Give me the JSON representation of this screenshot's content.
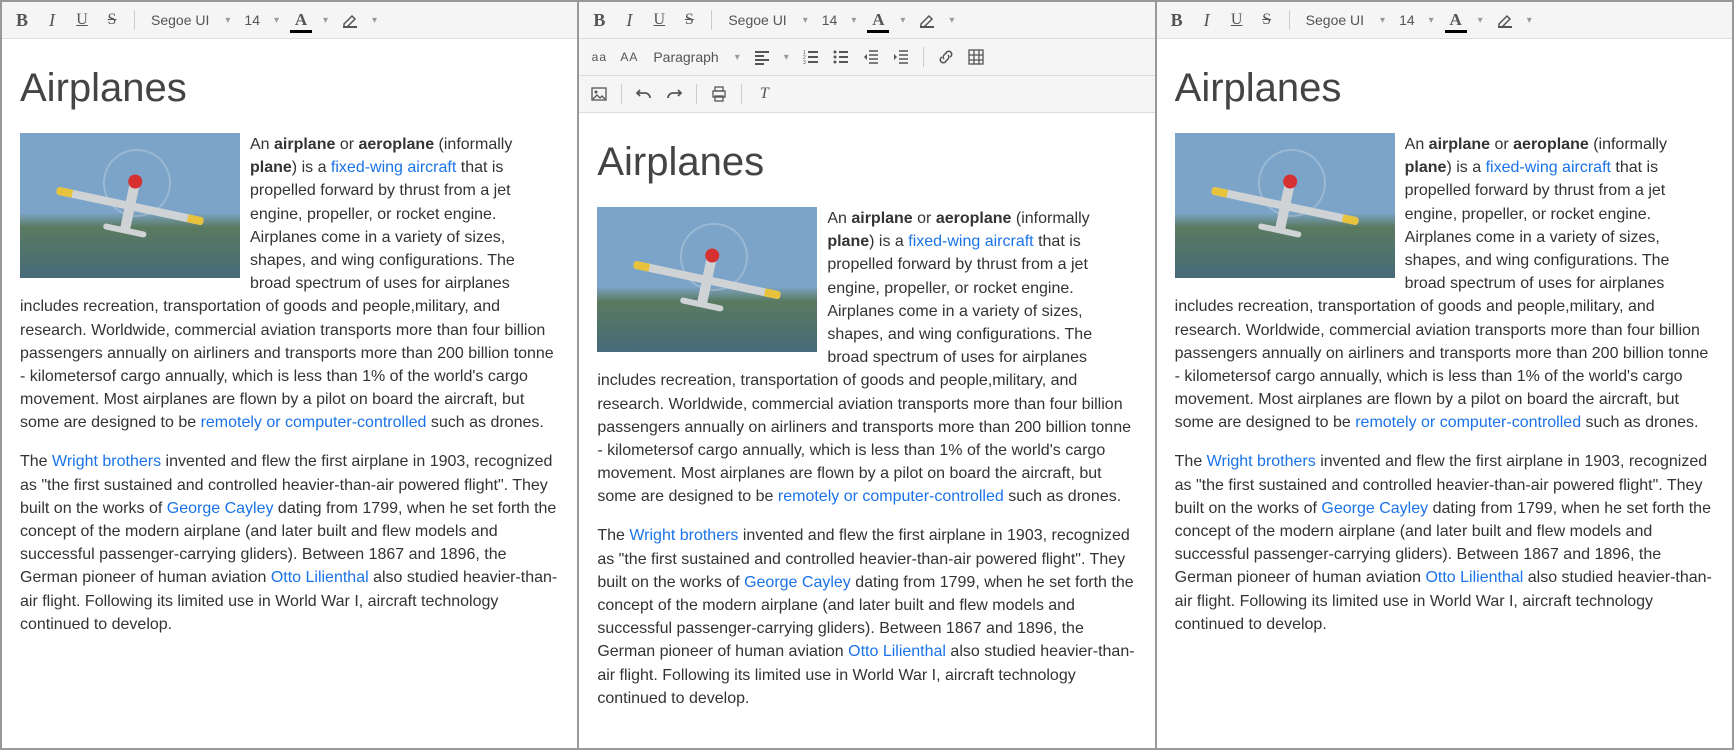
{
  "toolbar": {
    "bold": "B",
    "italic": "I",
    "underline": "U",
    "strike": "S",
    "font_name": "Segoe UI",
    "font_size": "14",
    "font_color_glyph": "A",
    "lowercase_glyph": "aa",
    "uppercase_glyph": "AA",
    "paragraph_label": "Paragraph"
  },
  "article": {
    "title": "Airplanes",
    "p1_prefix": "An ",
    "p1_airplane": "airplane",
    "p1_or": " or ",
    "p1_aeroplane": "aeroplane",
    "p1_informally": " (informally ",
    "p1_plane": "plane",
    "p1_isa": ") is a ",
    "link_fixed_wing": "fixed-wing aircraft",
    "p1_after_fixed": " that is propelled forward by thrust from a jet engine, propeller, or rocket engine. Airplanes come in a variety of sizes, shapes, and wing configurations. The broad spectrum of uses for airplanes includes recreation, transportation of goods and people,military, and research. Worldwide, commercial aviation transports more than four billion passengers annually on airliners and transports more than 200 billion tonne - kilometersof cargo annually, which is less than 1% of the world's cargo movement. Most airplanes are flown by a pilot on board the aircraft, but some are designed to be ",
    "link_remotely": "remotely or computer-controlled",
    "p1_suffix": " such as drones.",
    "p2_prefix": "The ",
    "link_wright": "Wright brothers",
    "p2_mid1": " invented and flew the first airplane in 1903, recognized as \"the first sustained and controlled heavier-than-air powered flight\". They built on the works of ",
    "link_cayley": "George Cayley",
    "p2_mid2": " dating from 1799, when he set forth the concept of the modern airplane (and later built and flew models and successful passenger-carrying gliders). Between 1867 and 1896, the German pioneer of human aviation ",
    "link_lilienthal": "Otto Lilienthal",
    "p2_suffix": " also studied heavier-than-air flight. Following its limited use in World War I, aircraft technology continued to develop."
  }
}
